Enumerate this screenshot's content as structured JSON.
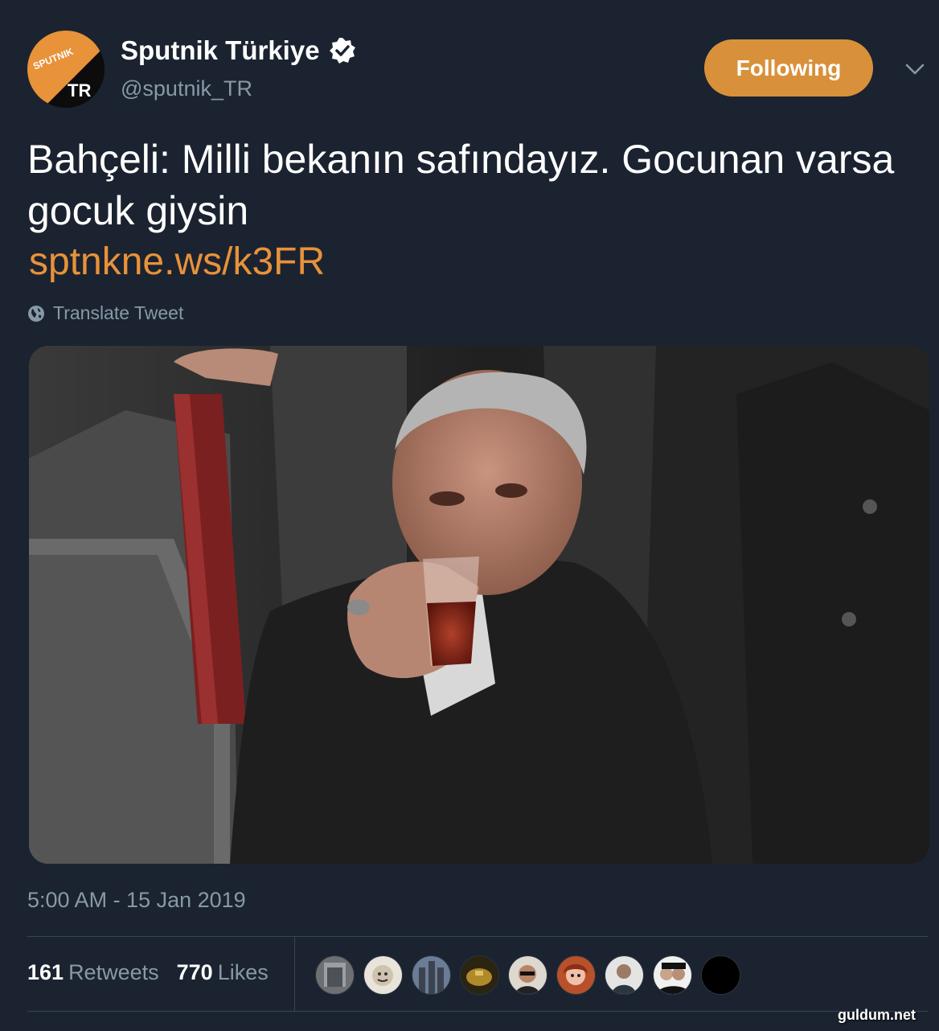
{
  "account": {
    "display_name": "Sputnik Türkiye",
    "handle": "@sputnik_TR",
    "avatar": {
      "logo_text": "SPUTNIK",
      "region_text": "TR",
      "accent_color": "#e8923a",
      "background_color": "#0c0c0c"
    },
    "verified_icon": "verified-badge-icon"
  },
  "actions": {
    "follow_label": "Following",
    "follow_color": "#d8913a",
    "menu_icon": "chevron-down-icon"
  },
  "tweet": {
    "text": "Bahçeli: Milli bekanın safındayız. Gocunan varsa gocuk giysin",
    "link": "sptnkne.ws/k3FR",
    "link_color": "#e8923a",
    "translate_label": "Translate Tweet",
    "translate_icon": "globe-icon"
  },
  "meta": {
    "timestamp": "5:00 AM - 15 Jan 2019",
    "retweets_count": "161",
    "retweets_label": "Retweets",
    "likes_count": "770",
    "likes_label": "Likes",
    "liker_count_shown": 9
  },
  "watermark": "guldum.net",
  "colors": {
    "background": "#1b2330",
    "muted_text": "#8899a6",
    "divider": "#38444d"
  }
}
